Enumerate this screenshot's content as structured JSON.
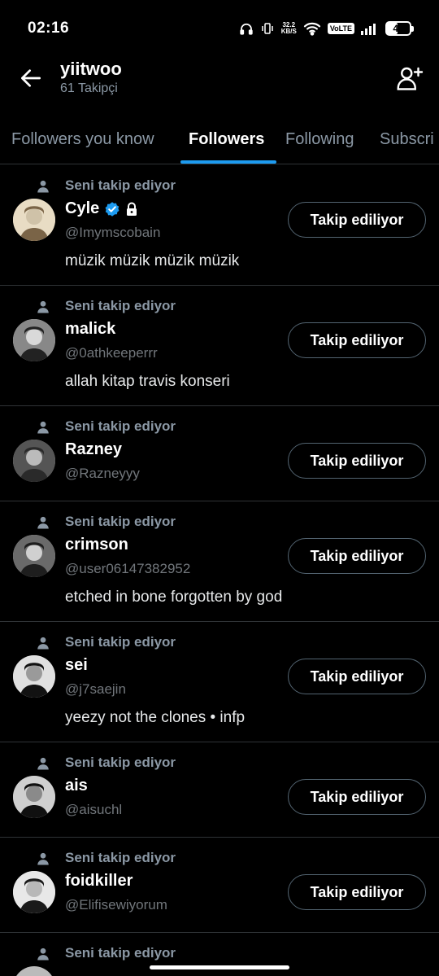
{
  "status_bar": {
    "time": "02:16",
    "net_speed_top": "32.2",
    "net_speed_bottom": "KB/S",
    "volte": "VoLTE",
    "battery": "46",
    "battery_level": 0.46
  },
  "header": {
    "title": "yiitwoo",
    "subtitle": "61 Takipçi"
  },
  "tabs": [
    {
      "label": "Followers you know",
      "active": false
    },
    {
      "label": "Followers",
      "active": true
    },
    {
      "label": "Following",
      "active": false
    },
    {
      "label": "Subscri",
      "active": false
    }
  ],
  "colors": {
    "accent": "#1d9bf0",
    "background": "#000000",
    "secondary_text": "#71767b"
  },
  "users": [
    {
      "follows_you": "Seni takip ediyor",
      "name": "Cyle",
      "verified": true,
      "protected": true,
      "handle": "@Imymscobain",
      "bio": "müzik müzik müzik müzik",
      "button": "Takip ediliyor",
      "avatar_icon": "avatar-cyle"
    },
    {
      "follows_you": "Seni takip ediyor",
      "name": "malick",
      "verified": false,
      "protected": false,
      "handle": "@0athkeeperrr",
      "bio": "allah kitap travis konseri",
      "button": "Takip ediliyor",
      "avatar_icon": "avatar-malick"
    },
    {
      "follows_you": "Seni takip ediyor",
      "name": "Razney",
      "verified": false,
      "protected": false,
      "handle": "@Razneyyy",
      "bio": "",
      "button": "Takip ediliyor",
      "avatar_icon": "avatar-razney"
    },
    {
      "follows_you": "Seni takip ediyor",
      "name": "crimson",
      "verified": false,
      "protected": false,
      "handle": "@user06147382952",
      "bio": "etched in bone forgotten by god",
      "button": "Takip ediliyor",
      "avatar_icon": "avatar-crimson"
    },
    {
      "follows_you": "Seni takip ediyor",
      "name": "sei",
      "verified": false,
      "protected": false,
      "handle": "@j7saejin",
      "bio": "yeezy not the clones • infp",
      "button": "Takip ediliyor",
      "avatar_icon": "avatar-sei"
    },
    {
      "follows_you": "Seni takip ediyor",
      "name": "ais",
      "verified": false,
      "protected": false,
      "handle": "@aisuchl",
      "bio": "",
      "button": "Takip ediliyor",
      "avatar_icon": "avatar-ais"
    },
    {
      "follows_you": "Seni takip ediyor",
      "name": "foidkiller",
      "verified": false,
      "protected": false,
      "handle": "@Elifisewiyorum",
      "bio": "",
      "button": "Takip ediliyor",
      "avatar_icon": "avatar-foidkiller"
    },
    {
      "follows_you": "Seni takip ediyor",
      "name": "",
      "verified": false,
      "protected": false,
      "handle": "",
      "bio": "",
      "button": "",
      "avatar_icon": "avatar-partial"
    }
  ]
}
